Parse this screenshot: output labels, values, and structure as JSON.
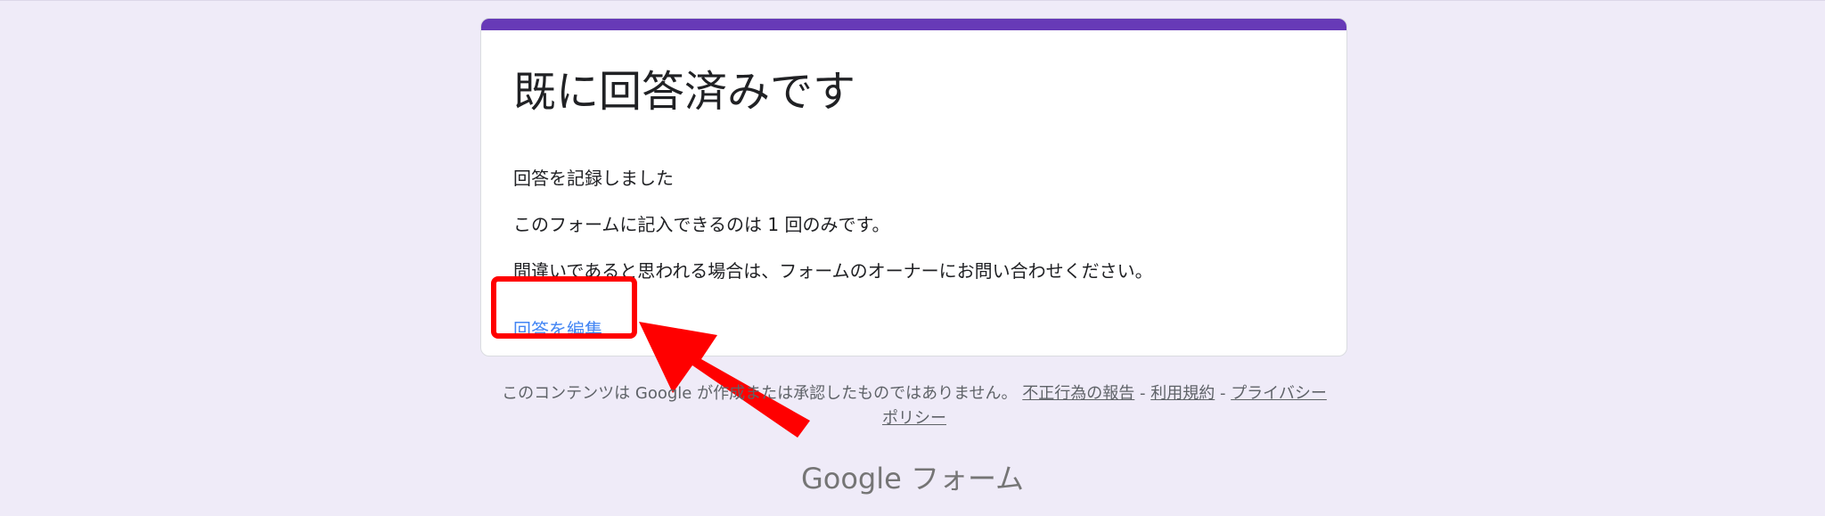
{
  "card": {
    "title": "既に回答済みです",
    "message1": "回答を記録しました",
    "message2": "このフォームに記入できるのは 1 回のみです。",
    "message3": "間違いであると思われる場合は、フォームのオーナーにお問い合わせください。",
    "edit_link": "回答を編集"
  },
  "footer": {
    "disclaimer": "このコンテンツは Google が作成または承認したものではありません。",
    "report_link": "不正行為の報告",
    "sep1": " - ",
    "terms_link": "利用規約",
    "sep2": " - ",
    "privacy_link": "プライバシー ポリシー"
  },
  "branding": {
    "google": "Google",
    "product": "フォーム"
  },
  "colors": {
    "background": "#efebf8",
    "accent": "#673ab7",
    "link": "#4285f4",
    "annotation": "#ff0000"
  },
  "icons": {
    "annotation_arrow": "red-arrow-icon"
  }
}
